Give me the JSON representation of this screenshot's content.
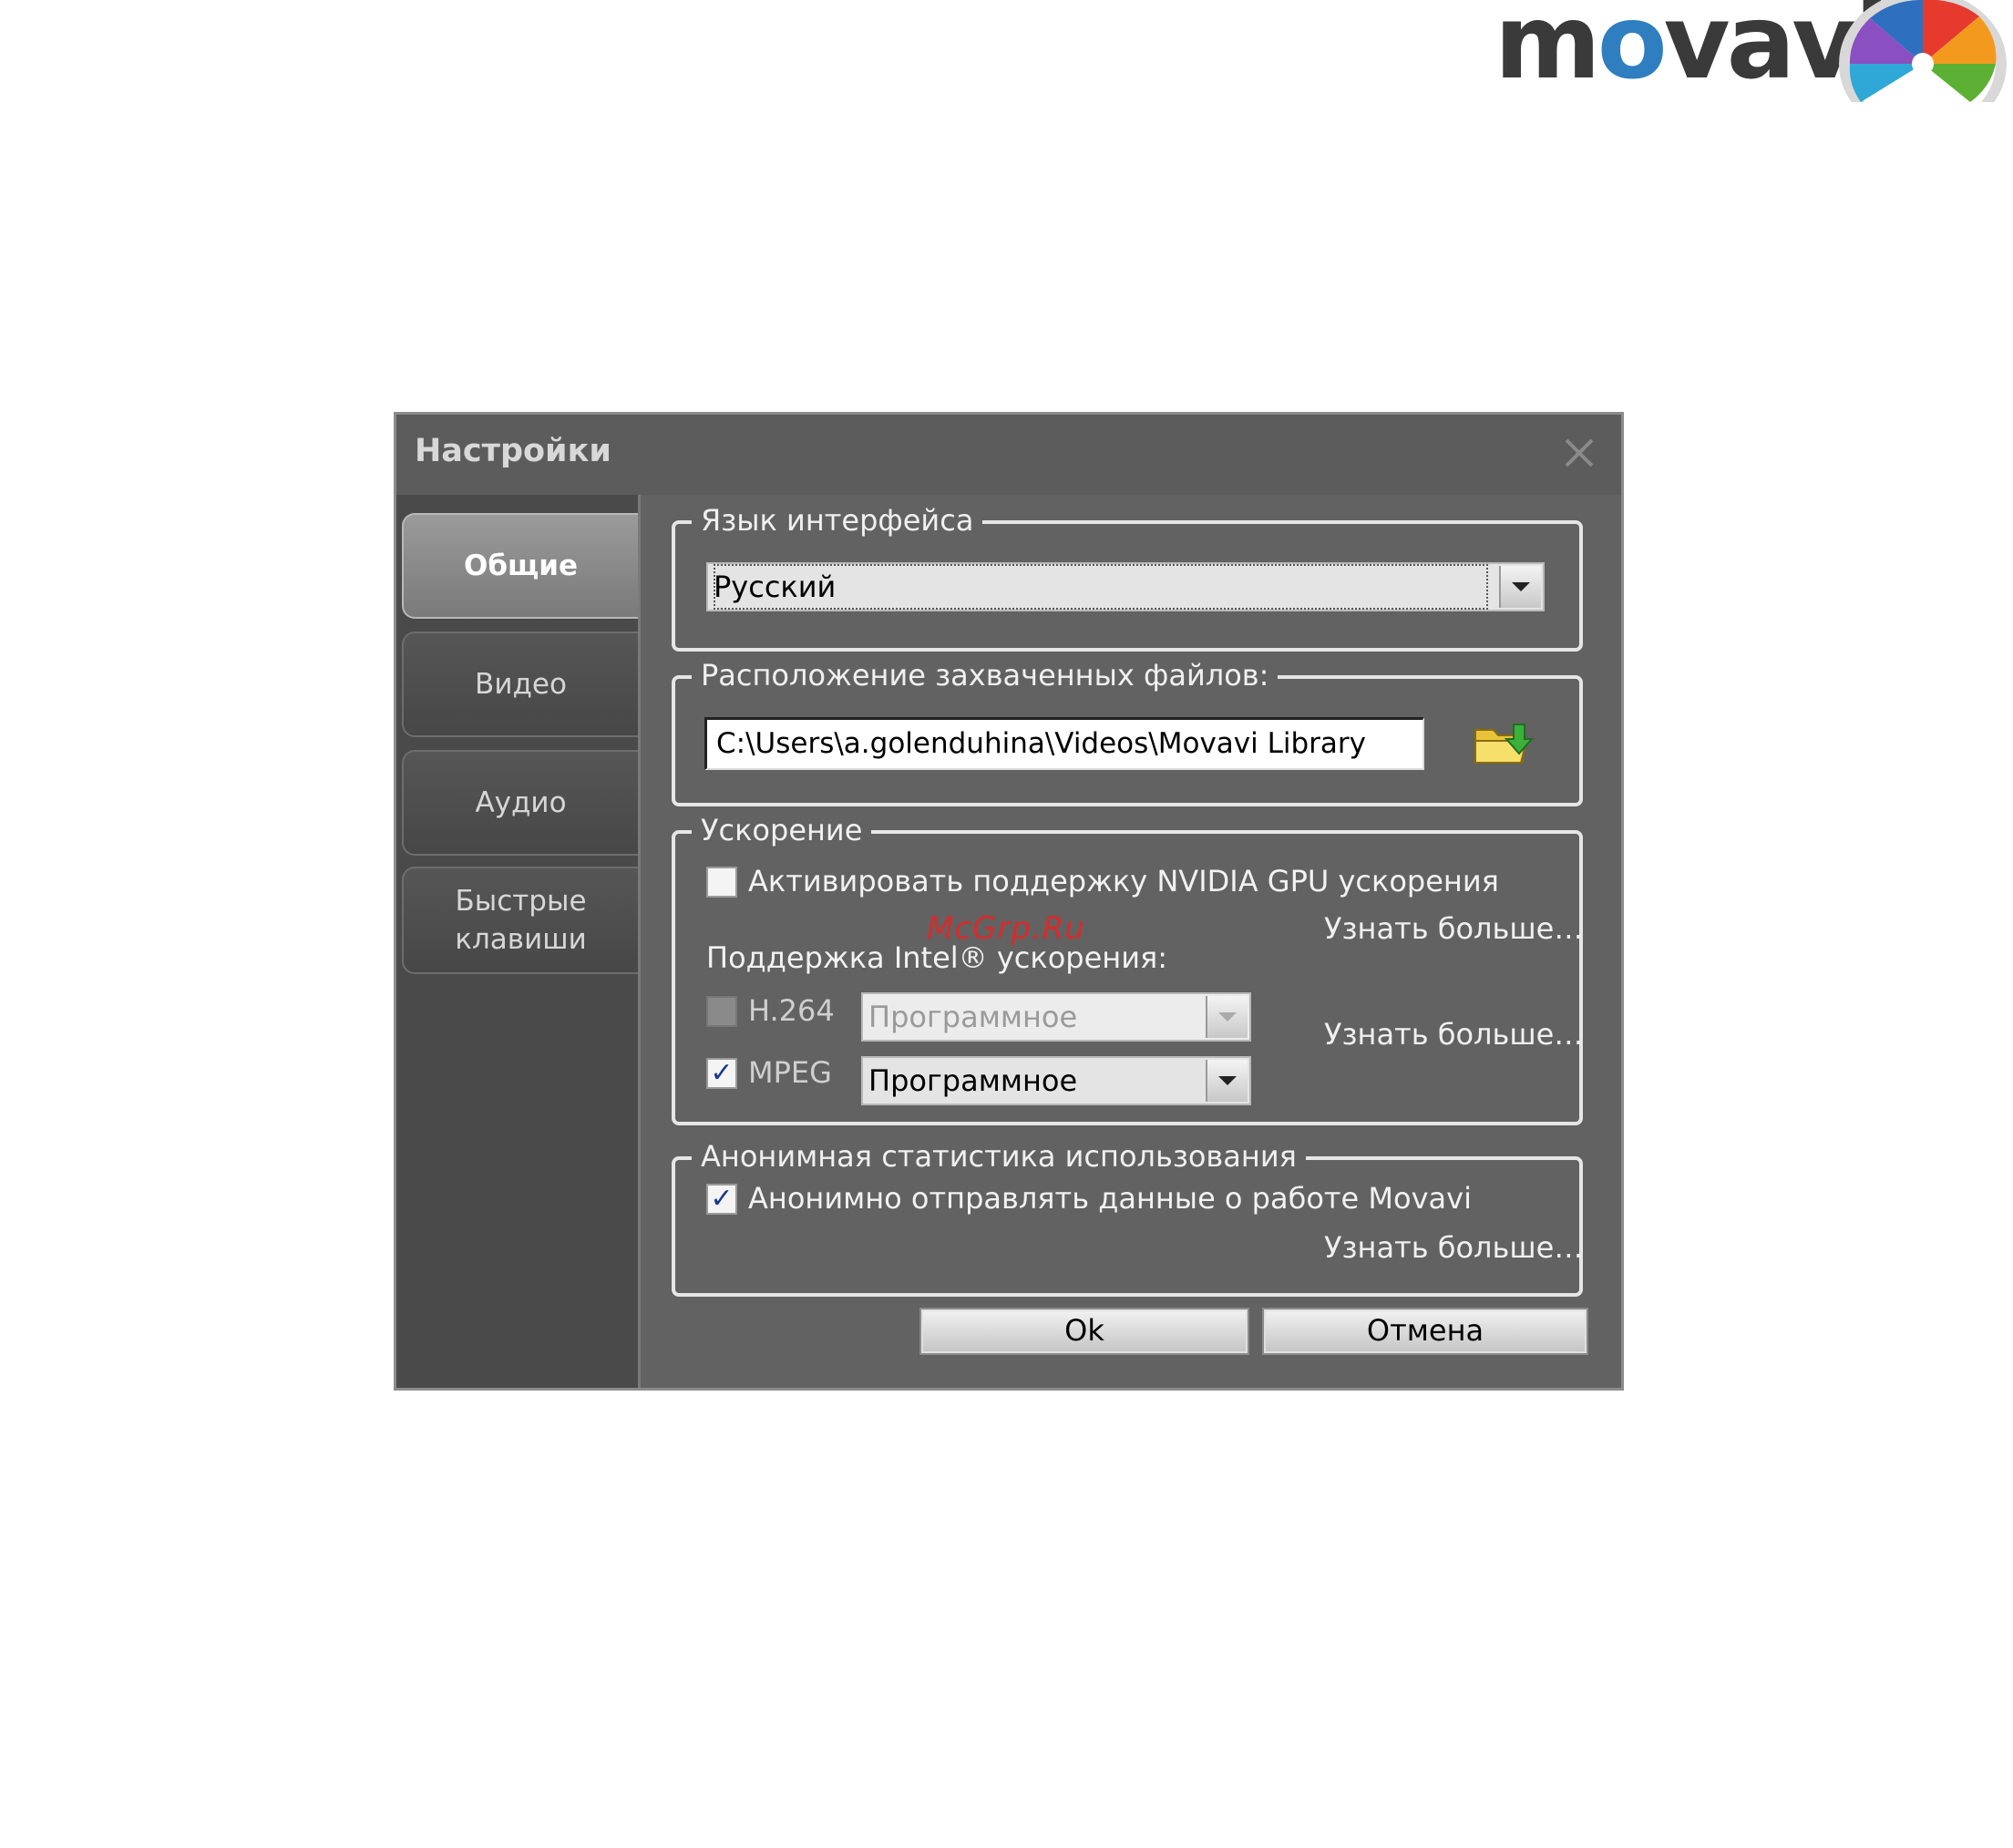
{
  "logo": {
    "text_pre": "m",
    "text_o": "o",
    "text_post": "vavi"
  },
  "dialog": {
    "title": "Настройки",
    "close_icon": "close-icon"
  },
  "sidebar": {
    "tabs": [
      {
        "label": "Общие",
        "active": true
      },
      {
        "label": "Видео",
        "active": false
      },
      {
        "label": "Аудио",
        "active": false
      },
      {
        "label": "Быстрые клавиши",
        "active": false
      }
    ]
  },
  "language": {
    "legend": "Язык интерфейса",
    "selected": "Русский"
  },
  "location": {
    "legend": "Расположение захваченных файлов:",
    "path": "C:\\Users\\a.golenduhina\\Videos\\Movavi Library",
    "browse_icon": "folder-icon"
  },
  "acceleration": {
    "legend": "Ускорение",
    "nvidia_label": "Активировать поддержку NVIDIA GPU ускорения",
    "nvidia_checked": false,
    "learn_more_1": "Узнать больше…",
    "intel_label": "Поддержка Intel® ускорения:",
    "h264_label": "H.264",
    "h264_checked": false,
    "h264_mode": "Программное",
    "mpeg_label": "MPEG",
    "mpeg_checked": true,
    "mpeg_mode": "Программное",
    "learn_more_2": "Узнать больше…"
  },
  "statistics": {
    "legend": "Анонимная статистика использования",
    "send_label": "Анонимно отправлять данные о работе Movavi",
    "send_checked": true,
    "learn_more": "Узнать больше…"
  },
  "buttons": {
    "ok": "Ok",
    "cancel": "Отмена"
  },
  "watermark": "McGrp.Ru",
  "colors": {
    "dialog_bg": "#626262",
    "sidebar_bg": "#4a4a4a",
    "watermark": "#d92b2b",
    "check": "#1a3a8a"
  }
}
